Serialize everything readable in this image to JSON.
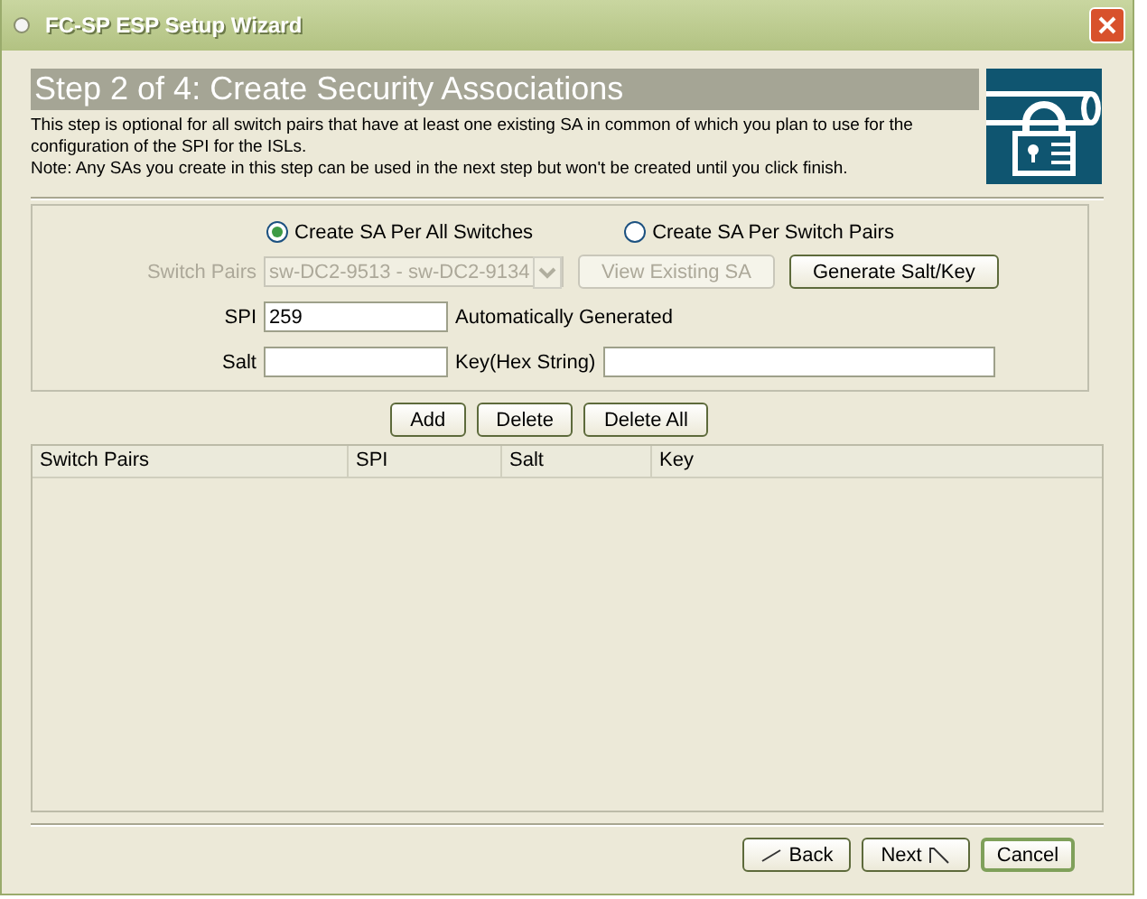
{
  "window": {
    "title": "FC-SP ESP Setup Wizard"
  },
  "header": {
    "title": "Step 2 of 4: Create Security Associations",
    "description": "This step is optional for all switch pairs that have at least one existing SA in common of which you plan to use for the configuration of the SPI for the ISLs.",
    "note": "Note: Any SAs you create in this step can be used in the next step but won't be created until you click finish."
  },
  "mode_options": [
    {
      "label": "Create SA Per All Switches",
      "selected": true
    },
    {
      "label": "Create SA Per Switch Pairs",
      "selected": false
    }
  ],
  "switch_pairs": {
    "label": "Switch Pairs",
    "value": "sw-DC2-9513 - sw-DC2-9134",
    "disabled": true
  },
  "pair_buttons": [
    {
      "label": "View Existing SA",
      "disabled": true
    },
    {
      "label": "Generate Salt/Key",
      "disabled": false
    }
  ],
  "spi": {
    "label": "SPI",
    "value": "259",
    "note": "Automatically Generated"
  },
  "salt": {
    "label": "Salt"
  },
  "key": {
    "label": "Key(Hex String)"
  },
  "list_buttons": [
    "Add",
    "Delete",
    "Delete All"
  ],
  "table": {
    "columns": [
      "Switch Pairs",
      "SPI",
      "Salt",
      "Key"
    ]
  },
  "footer_buttons": [
    {
      "label": "Back",
      "kind": "back",
      "default": false
    },
    {
      "label": "Next",
      "kind": "next",
      "default": false
    },
    {
      "label": "Cancel",
      "kind": "cancel",
      "default": true
    }
  ]
}
